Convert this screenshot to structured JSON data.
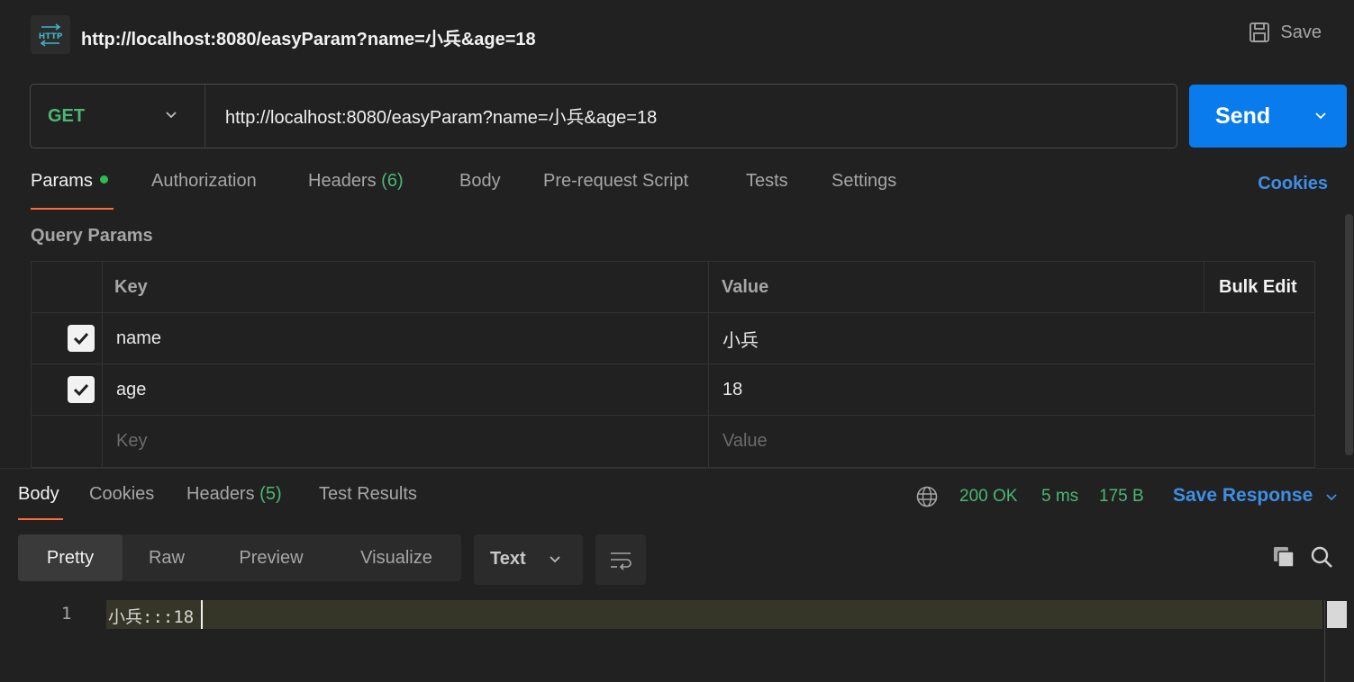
{
  "title": "http://localhost:8080/easyParam?name=小兵&age=18",
  "toolbar": {
    "save_label": "Save",
    "http_badge": "HTTP"
  },
  "request": {
    "method": "GET",
    "url": "http://localhost:8080/easyParam?name=小兵&age=18",
    "send_label": "Send"
  },
  "request_tabs": {
    "params": "Params",
    "authorization": "Authorization",
    "headers": "Headers",
    "headers_count": "(6)",
    "body": "Body",
    "prerequest": "Pre-request Script",
    "tests": "Tests",
    "settings": "Settings",
    "cookies": "Cookies"
  },
  "query_params": {
    "title": "Query Params",
    "columns": {
      "key": "Key",
      "value": "Value",
      "bulk_edit": "Bulk Edit"
    },
    "rows": [
      {
        "key": "name",
        "value": "小兵",
        "checked": true
      },
      {
        "key": "age",
        "value": "18",
        "checked": true
      }
    ],
    "placeholder": {
      "key": "Key",
      "value": "Value"
    }
  },
  "response_tabs": {
    "body": "Body",
    "cookies": "Cookies",
    "headers": "Headers",
    "headers_count": "(5)",
    "test_results": "Test Results"
  },
  "response_status": {
    "status": "200 OK",
    "time": "5 ms",
    "size": "175 B",
    "save_response": "Save Response"
  },
  "view_modes": [
    "Pretty",
    "Raw",
    "Preview",
    "Visualize"
  ],
  "format": "Text",
  "code": {
    "line_number": "1",
    "content": "小兵:::18"
  },
  "colors": {
    "accent": "#097bed",
    "success": "#4bb773",
    "tab_underline": "#ff6c37",
    "link": "#3f8ee6"
  }
}
